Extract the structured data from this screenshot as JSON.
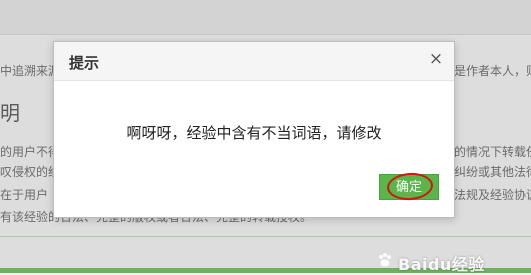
{
  "background": {
    "lines": [
      "中追溯来源",
      "是作者本人，则",
      "的用户不得",
      "的情况下转载任",
      "叹侵权的经",
      "纠纷或其他法律",
      "在于用户",
      "法规及经验协议",
      "有该经验的合法、完整的版权或者合法、完整的转载授权。"
    ],
    "heading": "明"
  },
  "dialog": {
    "title": "提示",
    "close_glyph": "×",
    "message": "啊呀呀，经验中含有不当词语，请修改",
    "ok_label": "确定"
  },
  "watermark": {
    "text": "Baidu经验"
  },
  "colors": {
    "ok_button": "#5ab54a",
    "annotation_circle": "#d01515"
  }
}
